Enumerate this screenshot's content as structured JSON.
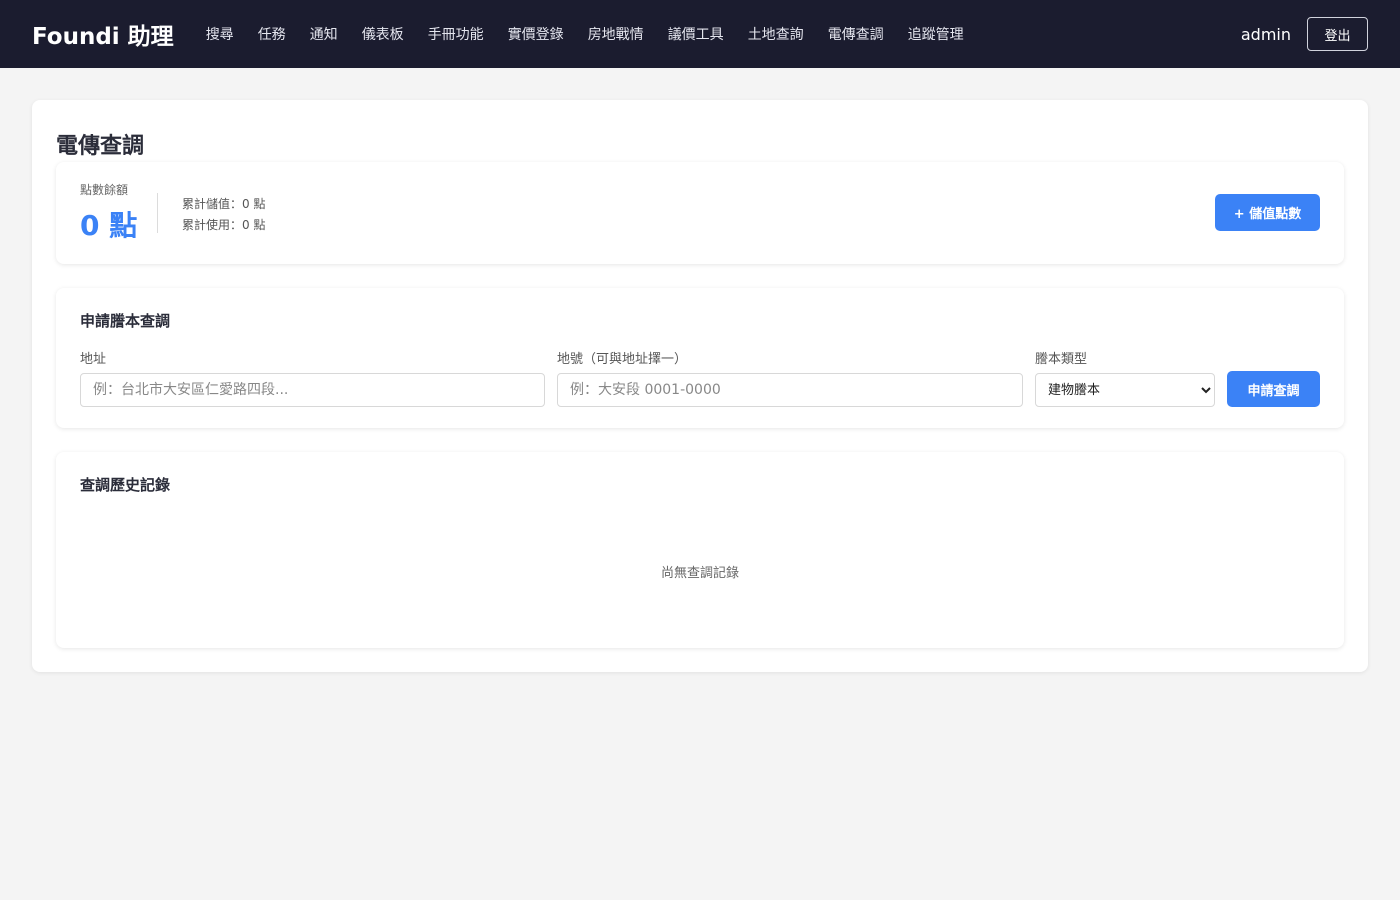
{
  "nav": {
    "brand": "Foundi 助理",
    "links": [
      "搜尋",
      "任務",
      "通知",
      "儀表板",
      "手冊功能",
      "實價登錄",
      "房地戰情",
      "議價工具",
      "土地查詢",
      "電傳查調",
      "追蹤管理"
    ],
    "username": "admin",
    "logout": "登出"
  },
  "page": {
    "title": "電傳查調"
  },
  "balance": {
    "label": "點數餘額",
    "value": "0 點",
    "total_topup": "累計儲值：0 點",
    "total_used": "累計使用：0 點",
    "topup_button": "+ 儲值點數"
  },
  "apply": {
    "title": "申請謄本查調",
    "address_label": "地址",
    "address_placeholder": "例：台北市大安區仁愛路四段...",
    "lot_label": "地號（可與地址擇一）",
    "lot_placeholder": "例：大安段 0001-0000",
    "type_label": "謄本類型",
    "type_selected": "建物謄本",
    "submit_button": "申請查調"
  },
  "history": {
    "title": "查調歷史記錄",
    "empty_text": "尚無查調記錄"
  },
  "colors": {
    "navbar": "#1b1c2f",
    "accent": "#3b82f6",
    "background": "#f4f4f4"
  }
}
